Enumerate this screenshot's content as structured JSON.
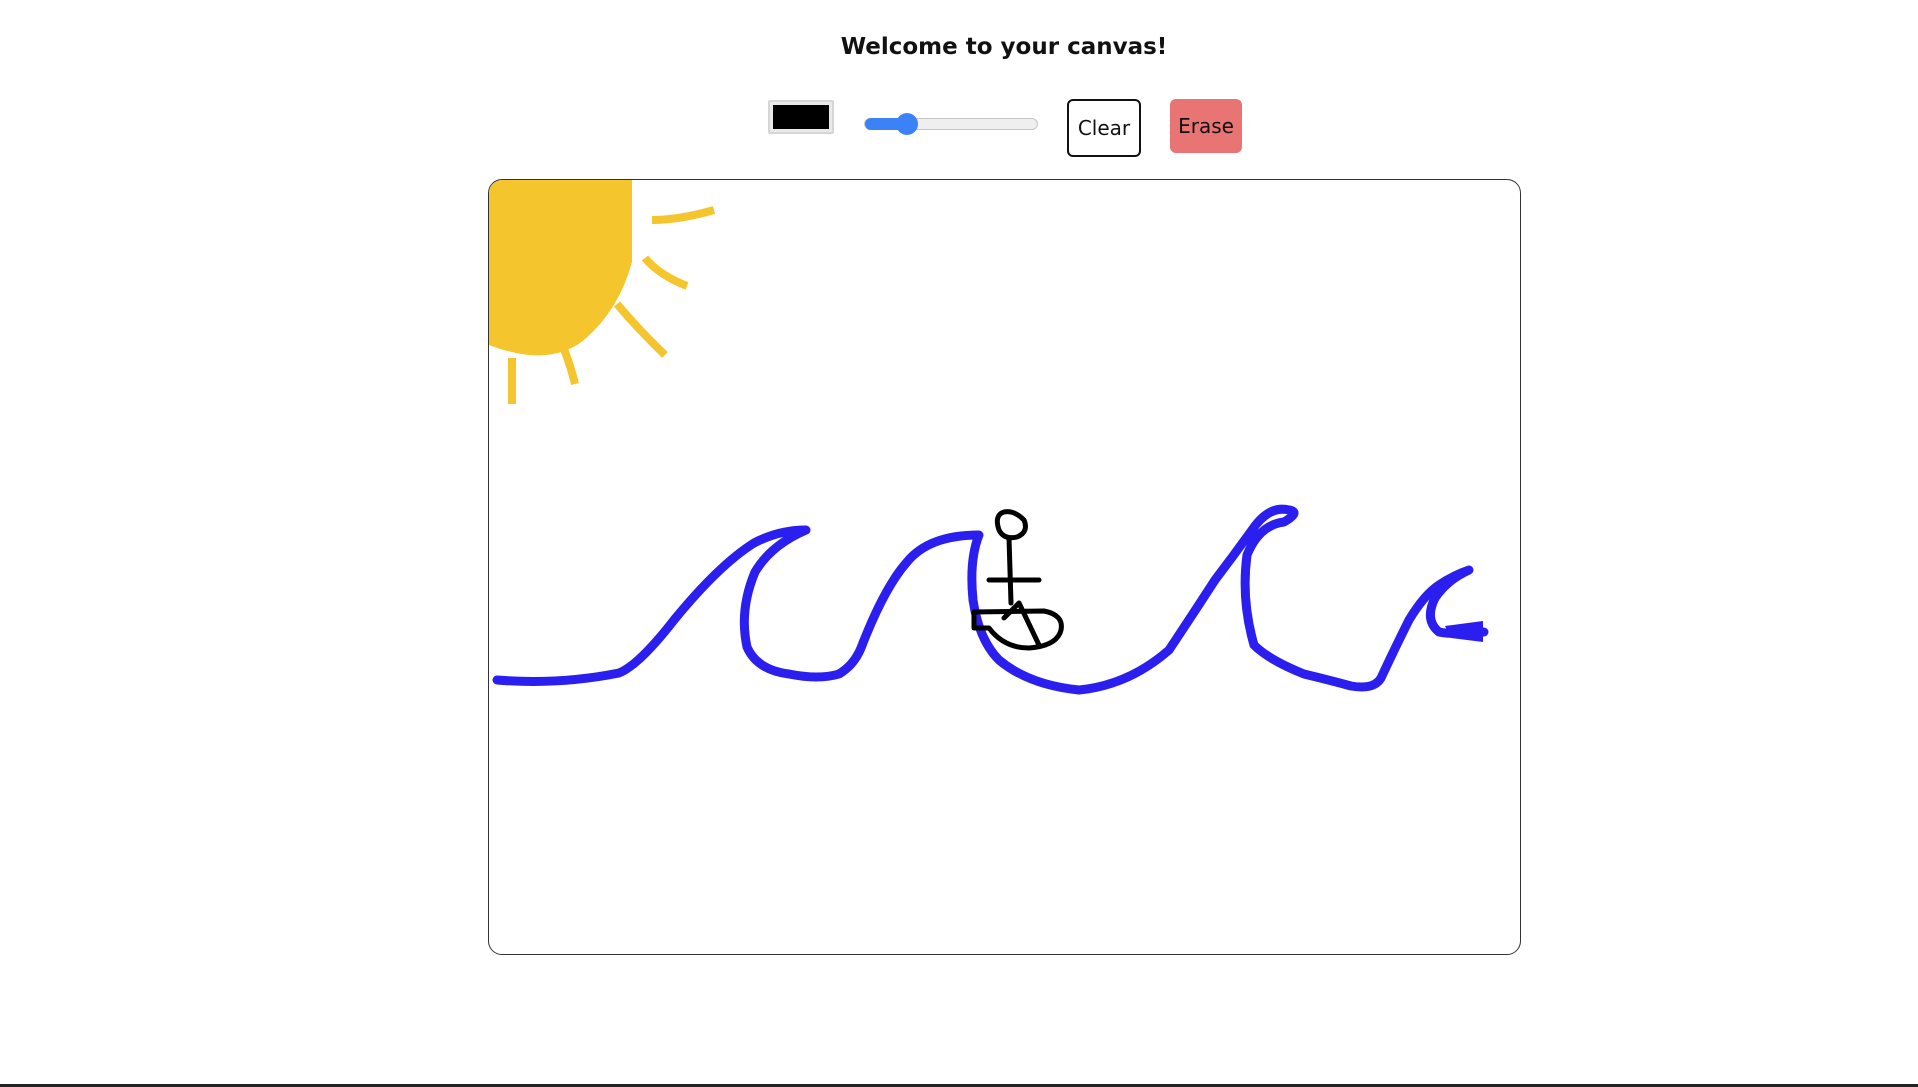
{
  "header": {
    "title": "Welcome to your canvas!"
  },
  "toolbar": {
    "color_value": "#000000",
    "brush_size_fraction": 0.24,
    "clear_label": "Clear",
    "erase_label": "Erase",
    "erase_color": "#e87474",
    "accent_color": "#3b82f6"
  },
  "canvas": {
    "stroke_colors": {
      "sun": "#f5c52e",
      "waves": "#2b1ff0",
      "figure": "#000000"
    }
  }
}
